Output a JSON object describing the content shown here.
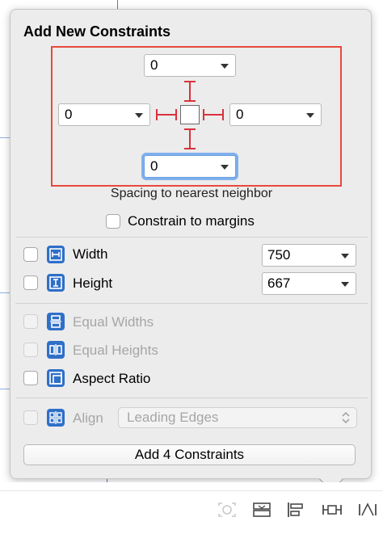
{
  "popover": {
    "title": "Add New Constraints",
    "spacing": {
      "top": "0",
      "left": "0",
      "right": "0",
      "bottom": "0",
      "caption": "Spacing to nearest neighbor"
    },
    "constrain_margins_label": "Constrain to margins",
    "width": {
      "label": "Width",
      "value": "750"
    },
    "height": {
      "label": "Height",
      "value": "667"
    },
    "equal_widths_label": "Equal Widths",
    "equal_heights_label": "Equal Heights",
    "aspect_ratio_label": "Aspect Ratio",
    "align": {
      "label": "Align",
      "value": "Leading Edges"
    },
    "add_button_label": "Add 4 Constraints"
  },
  "colors": {
    "accent_blue": "#2f6fc8",
    "constraint_red": "#d9323c",
    "highlight_box": "#e8493c"
  },
  "toolbar_icons": [
    "resolve-autolayout-icon",
    "stack-icon",
    "align-icon",
    "pin-icon",
    "resolve-issues-icon"
  ]
}
